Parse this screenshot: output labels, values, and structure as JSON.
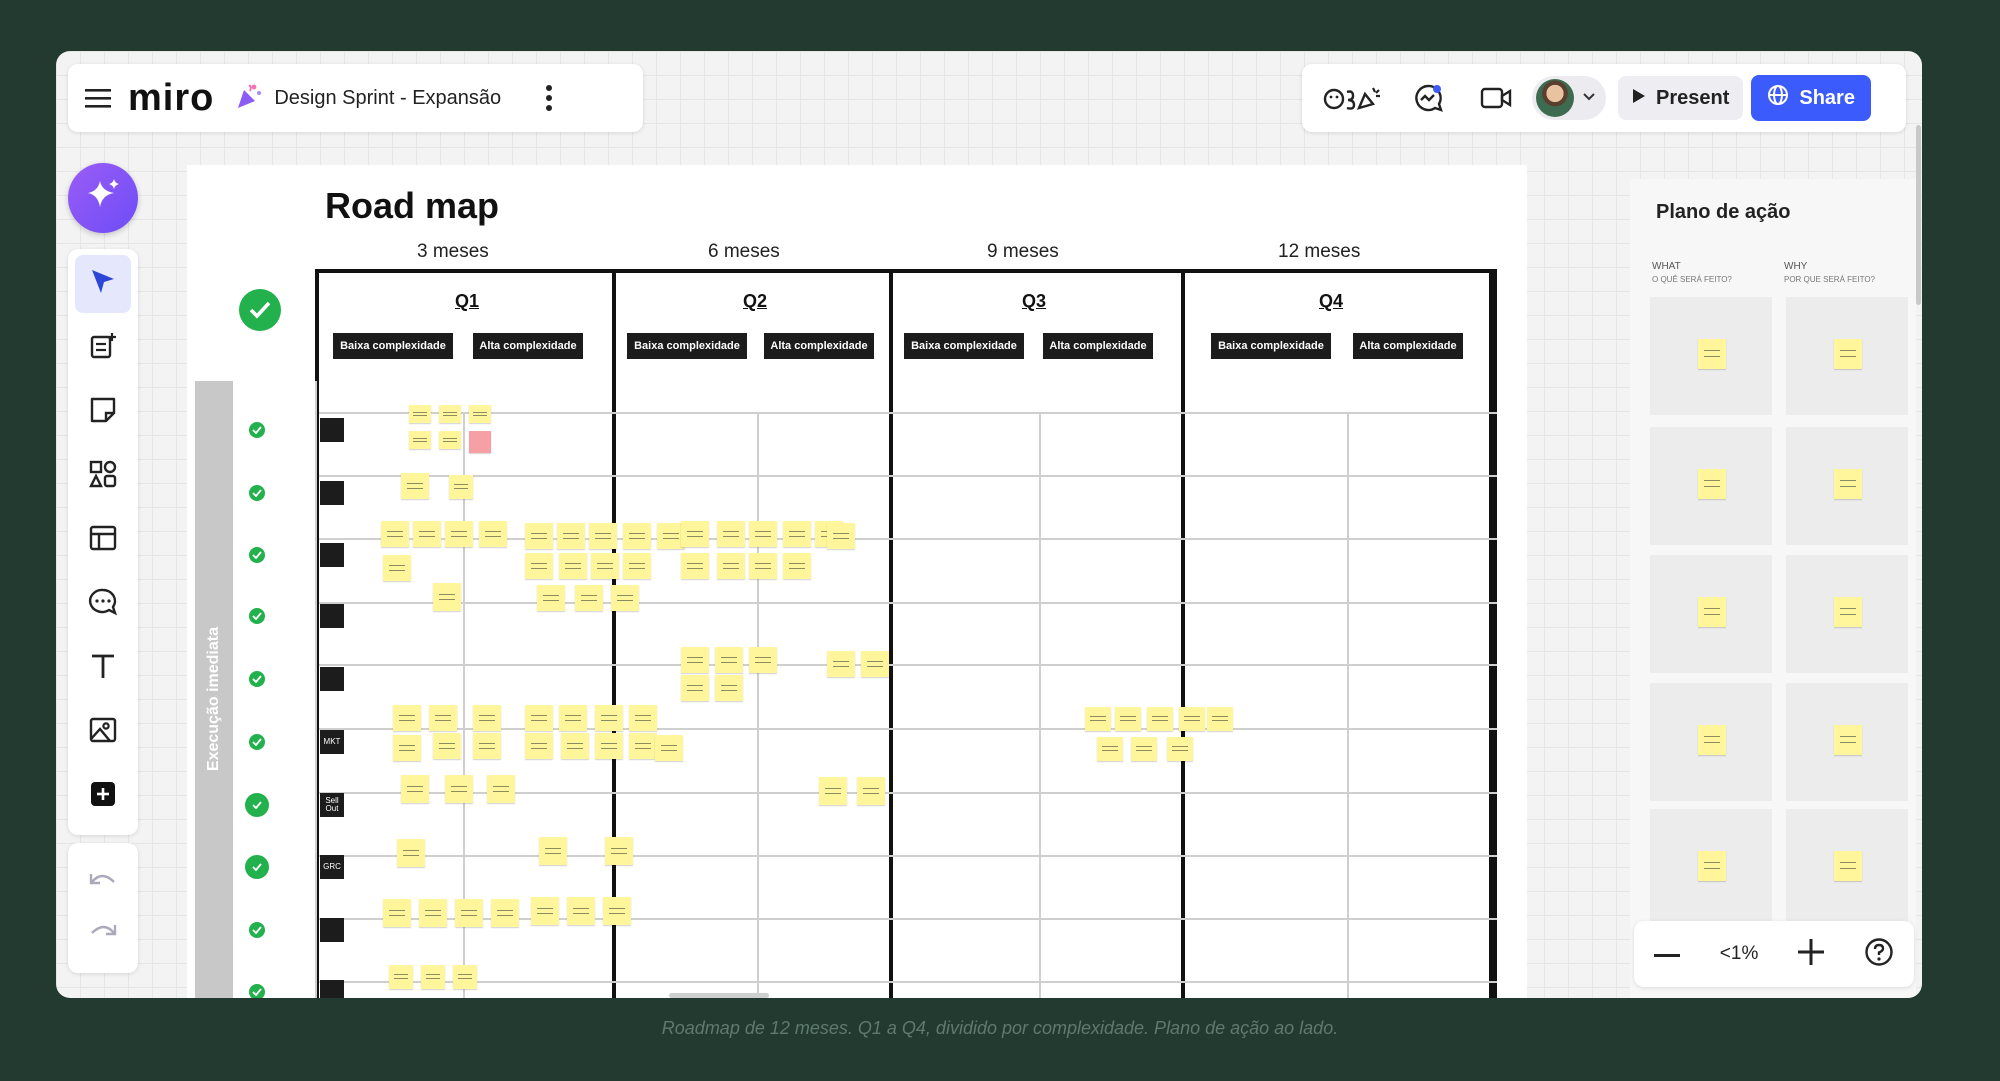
{
  "header": {
    "app_name": "miro",
    "board_title": "Design Sprint - Expansão"
  },
  "topbar": {
    "present_label": "Present",
    "share_label": "Share"
  },
  "board": {
    "title": "Road map",
    "months": [
      "3 meses",
      "6 meses",
      "9 meses",
      "12 meses"
    ],
    "quarters": [
      "Q1",
      "Q2",
      "Q3",
      "Q4"
    ],
    "complexity_low": "Baixa complexidade",
    "complexity_high": "Alta complexidade",
    "section_label": "Execução imediata",
    "row_tags": [
      "",
      "",
      "",
      "",
      "",
      "MKT",
      "Sell Out",
      "GRC",
      "",
      ""
    ]
  },
  "panel": {
    "title": "Plano de ação",
    "col1_header": "WHAT",
    "col1_sub": "O QUÊ SERÁ FEITO?",
    "col2_header": "WHY",
    "col2_sub": "POR QUE SERÁ FEITO?"
  },
  "zoom": {
    "value": "<1%"
  },
  "caption": "Roadmap de 12 meses. Q1 a Q4, dividido por complexidade. Plano de ação ao lado.",
  "colors": {
    "accent": "#3b5bfd",
    "check": "#22b14c",
    "sticky": "#fff59a"
  }
}
